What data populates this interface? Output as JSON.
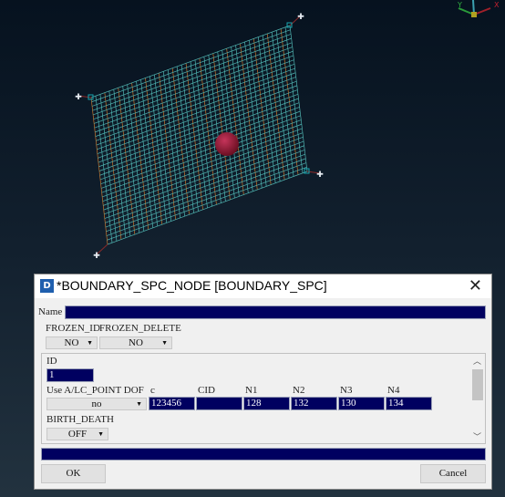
{
  "viewport": {
    "background": "#0e1b28",
    "mesh_color": "#4fb3b0",
    "mesh_accent": "#c7742a",
    "sphere_color": "#b0223f"
  },
  "axis_triad": {
    "y_label": "Y",
    "x_label": "X"
  },
  "dialog": {
    "icon": "lsdyna-app-icon",
    "title": "*BOUNDARY_SPC_NODE [BOUNDARY_SPC]",
    "close_icon": "close-icon",
    "name_label": "Name",
    "name_value": "",
    "frozen_id_label": "FROZEN_ID",
    "frozen_id_value": "NO",
    "frozen_delete_label": "FROZEN_DELETE",
    "frozen_delete_value": "NO",
    "id_label": "ID",
    "id_value": "1",
    "use_label": "Use A/LC_POINT DOF",
    "use_value": "no",
    "columns": [
      {
        "label": "c",
        "value": "123456"
      },
      {
        "label": "CID",
        "value": ""
      },
      {
        "label": "N1",
        "value": "128"
      },
      {
        "label": "N2",
        "value": "132"
      },
      {
        "label": "N3",
        "value": "130"
      },
      {
        "label": "N4",
        "value": "134"
      }
    ],
    "birth_death_label": "BIRTH_DEATH",
    "birth_death_value": "OFF",
    "status_value": "",
    "ok_label": "OK",
    "cancel_label": "Cancel"
  }
}
